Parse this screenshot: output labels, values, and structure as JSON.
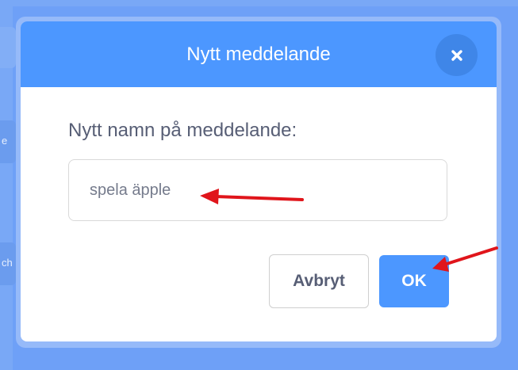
{
  "dialog": {
    "title": "Nytt meddelande",
    "close_icon": "close-icon",
    "field_label": "Nytt namn på meddelande:",
    "input_value": "spela äpple",
    "cancel_label": "Avbryt",
    "ok_label": "OK"
  },
  "background": {
    "tab_1_text": "e n",
    "tab_2_text": "ch"
  },
  "colors": {
    "backdrop": "#6ea0f7",
    "header": "#4c97ff",
    "ok_button": "#4c97ff",
    "label_text": "#575e75",
    "annotation_arrow": "#e0151b"
  }
}
